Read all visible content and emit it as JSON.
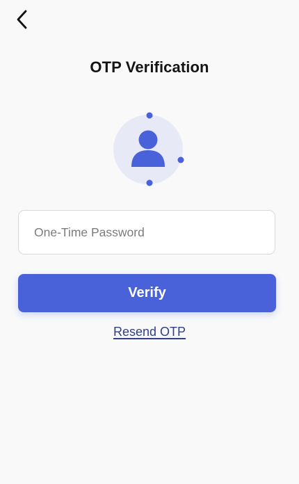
{
  "header": {
    "back_icon": "chevron-left-icon",
    "title": "OTP Verification"
  },
  "illustration": {
    "icon": "user-avatar-icon"
  },
  "form": {
    "otp_placeholder": "One-Time Password",
    "otp_value": "",
    "verify_label": "Verify",
    "resend_label": "Resend OTP"
  },
  "colors": {
    "accent": "#4a62d9",
    "avatar_bg": "#e8e9f6",
    "link": "#2f3f8a",
    "background": "#f9f9fa"
  }
}
